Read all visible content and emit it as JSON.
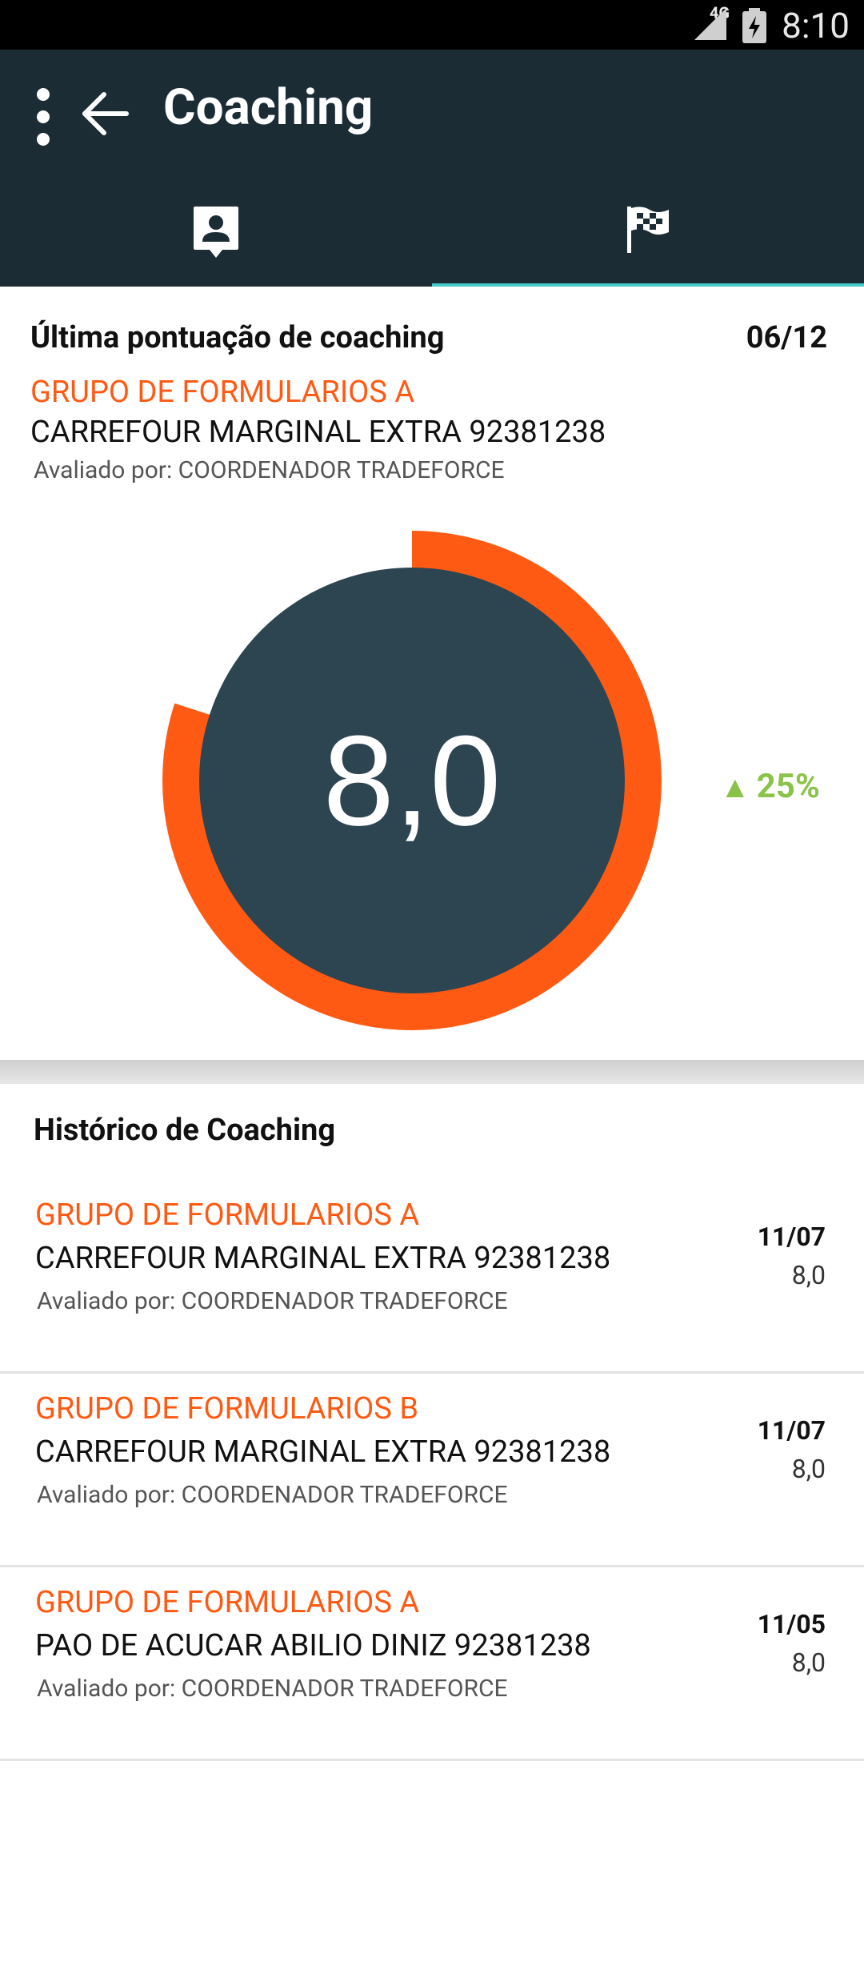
{
  "status_bar": {
    "network": "4G",
    "time": "8:10"
  },
  "app_bar": {
    "title": "Coaching",
    "menu_icon": "more-vert-icon",
    "back_icon": "arrow-back-icon"
  },
  "tabs": [
    {
      "icon": "contact-profile-icon",
      "selected": false
    },
    {
      "icon": "checkered-flag-icon",
      "selected": true
    }
  ],
  "latest": {
    "title": "Última pontuação de coaching",
    "date": "06/12",
    "group": "GRUPO DE FORMULARIOS A",
    "store": "CARREFOUR MARGINAL EXTRA 92381238",
    "evaluator": "Avaliado por: COORDENADOR TRADEFORCE",
    "score": "8,0",
    "score_value": 8.0,
    "score_max": 10,
    "trend": "25%",
    "trend_direction": "up"
  },
  "history": {
    "title": "Histórico de Coaching",
    "items": [
      {
        "group": "GRUPO DE FORMULARIOS A",
        "store": "CARREFOUR MARGINAL EXTRA 92381238",
        "evaluator": "Avaliado por: COORDENADOR TRADEFORCE",
        "date": "11/07",
        "score": "8,0"
      },
      {
        "group": "GRUPO DE FORMULARIOS B",
        "store": "CARREFOUR MARGINAL EXTRA 92381238",
        "evaluator": "Avaliado por: COORDENADOR TRADEFORCE",
        "date": "11/07",
        "score": "8,0"
      },
      {
        "group": "GRUPO DE FORMULARIOS A",
        "store": "PAO DE ACUCAR ABILIO DINIZ 92381238",
        "evaluator": "Avaliado por: COORDENADOR TRADEFORCE",
        "date": "11/05",
        "score": "8,0"
      }
    ]
  },
  "colors": {
    "app_bar": "#1b2c35",
    "accent_orange": "#ff5a13",
    "gauge_center": "#2d4550",
    "tab_indicator": "#46c9c9",
    "trend_green": "#8bc34a"
  }
}
